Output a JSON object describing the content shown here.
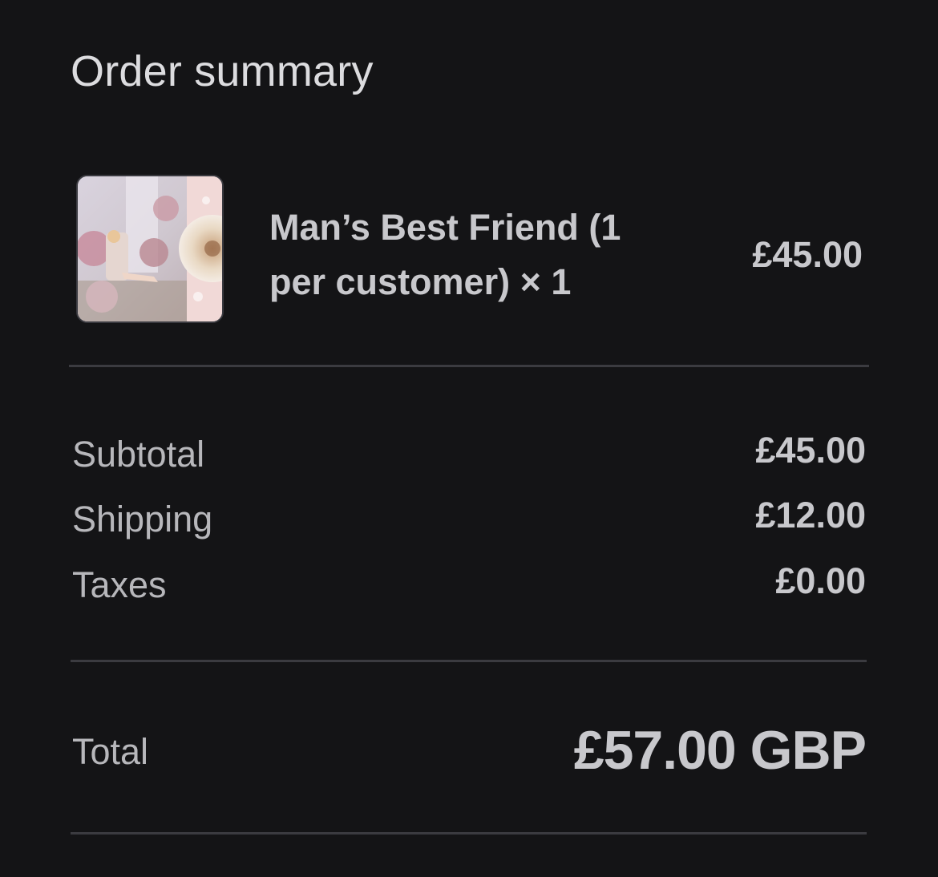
{
  "summary": {
    "title": "Order summary"
  },
  "item": {
    "name": "Man’s Best Friend (1 per customer) × 1",
    "price": "£45.00",
    "thumbnail": "album-cover-image"
  },
  "costs": {
    "subtotal_label": "Subtotal",
    "subtotal_value": "£45.00",
    "shipping_label": "Shipping",
    "shipping_value": "£12.00",
    "taxes_label": "Taxes",
    "taxes_value": "£0.00"
  },
  "total": {
    "label": "Total",
    "value": "£57.00 GBP"
  },
  "colors": {
    "background": "#141416",
    "text": "#c8c8cc",
    "divider": "#3b3b40"
  }
}
